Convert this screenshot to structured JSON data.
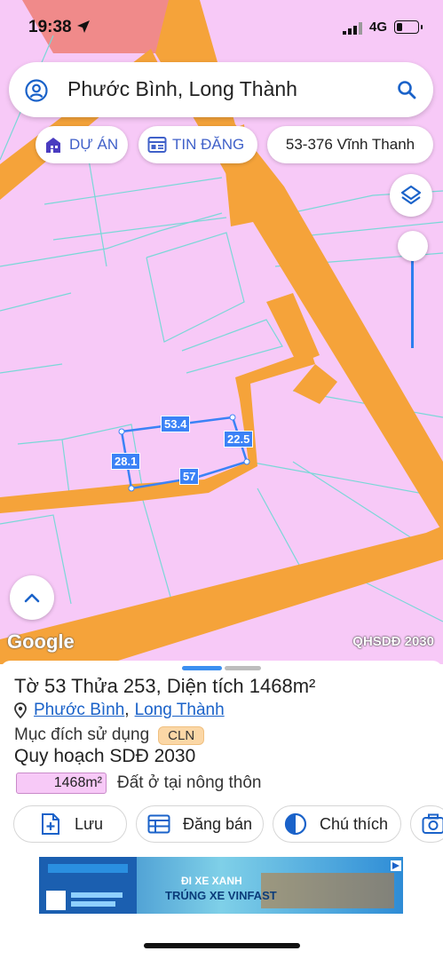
{
  "status": {
    "time": "19:38",
    "network": "4G"
  },
  "search": {
    "title": "Phước Bình, Long Thành"
  },
  "chips": {
    "du_an": "DỰ ÁN",
    "tin_dang": "TIN ĐĂNG",
    "parcel_code": "53-376 Vĩnh Thanh"
  },
  "map": {
    "measurements": {
      "top": "53.4",
      "left": "28.1",
      "right": "22.5",
      "bottom": "57"
    },
    "google": "Google",
    "layer_label": "QHSDĐ 2030",
    "colors": {
      "land": "#f7c9f7",
      "road": "#f5a33a",
      "parcel_line": "#3b82f6"
    }
  },
  "sheet": {
    "title": "Tờ 53 Thửa 253, Diện tích 1468m²",
    "ward": "Phước Bình",
    "district": "Long Thành",
    "purpose_label": "Mục đích sử dụng",
    "purpose_code": "CLN",
    "plan_title": "Quy hoạch SDĐ 2030",
    "legend_area": "1468m²",
    "legend_desc": "Đất ở tại nông thôn",
    "actions": {
      "save": "Lưu",
      "post": "Đăng bán",
      "note": "Chú thích"
    }
  },
  "ad": {
    "line1": "ĐI XE XANH",
    "line2": "TRÚNG XE VINFAST"
  }
}
